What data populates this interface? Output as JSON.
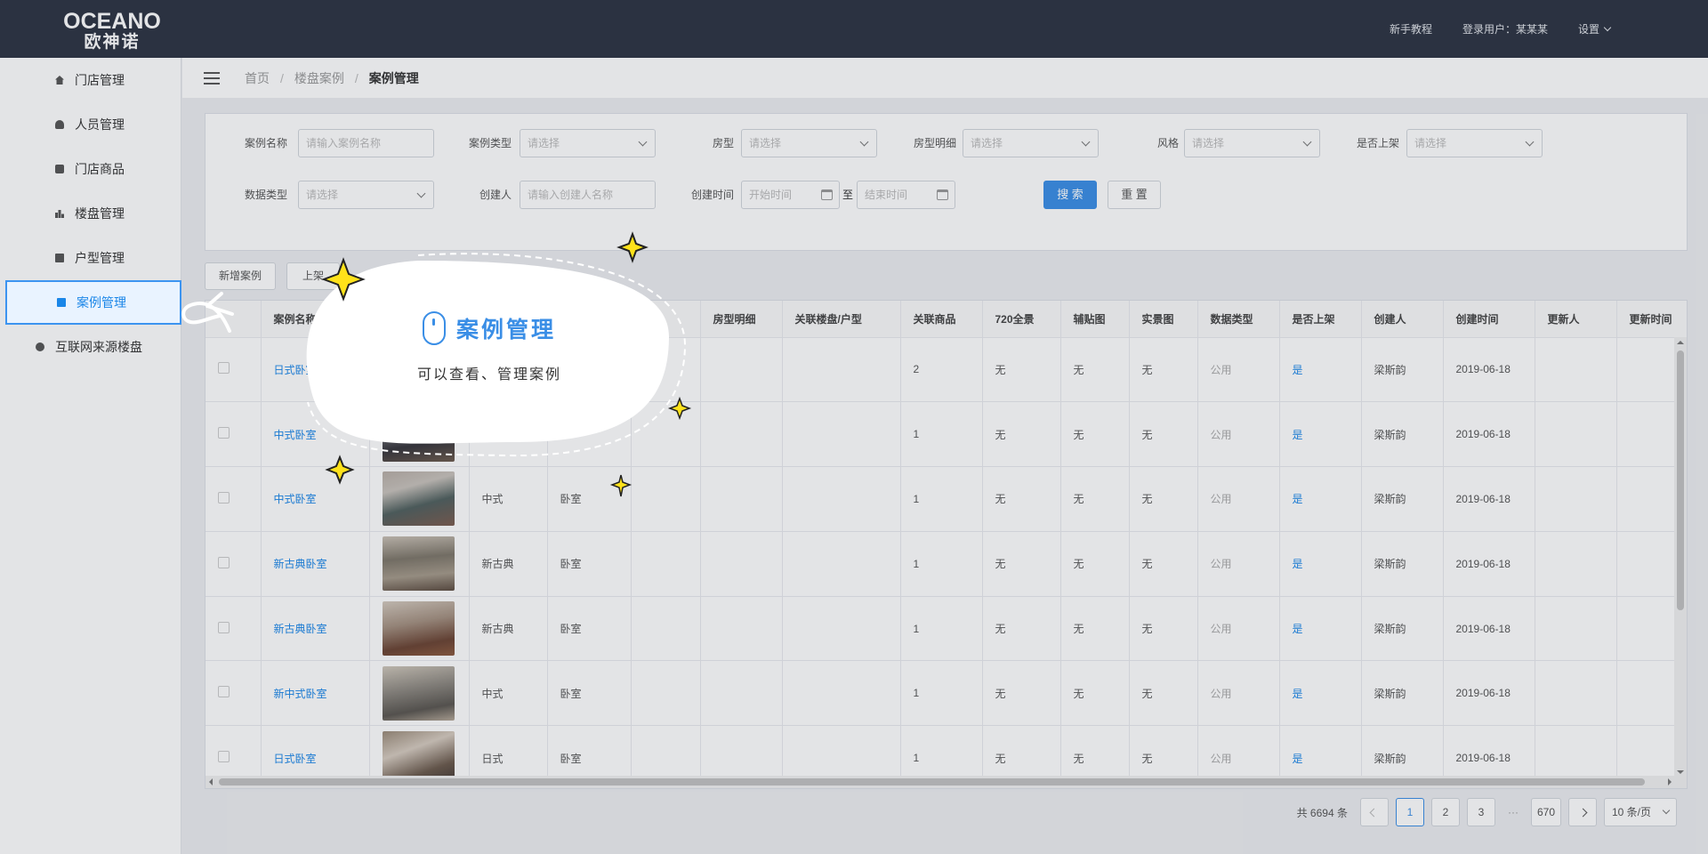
{
  "brand": {
    "en": "OCEANO",
    "cn": "欧神诺"
  },
  "header": {
    "tutorial": "新手教程",
    "user": "登录用户：某某某",
    "settings": "设置"
  },
  "sidebar": {
    "items": [
      {
        "label": "门店管理",
        "icon": "home-icon"
      },
      {
        "label": "人员管理",
        "icon": "user-icon"
      },
      {
        "label": "门店商品",
        "icon": "box-icon"
      },
      {
        "label": "楼盘管理",
        "icon": "bar-chart-icon"
      },
      {
        "label": "户型管理",
        "icon": "card-icon"
      },
      {
        "label": "案例管理",
        "icon": "image-icon",
        "active": true
      },
      {
        "label": "互联网来源楼盘",
        "icon": "globe-icon"
      }
    ]
  },
  "breadcrumb": [
    "首页",
    "楼盘案例",
    "案例管理"
  ],
  "filters": {
    "case_name": {
      "label": "案例名称",
      "placeholder": "请输入案例名称"
    },
    "case_type": {
      "label": "案例类型",
      "placeholder": "请选择"
    },
    "room_type": {
      "label": "房型",
      "placeholder": "请选择"
    },
    "room_detail": {
      "label": "房型明细",
      "placeholder": "请选择"
    },
    "style": {
      "label": "风格",
      "placeholder": "请选择"
    },
    "on_shelf": {
      "label": "是否上架",
      "placeholder": "请选择"
    },
    "data_type": {
      "label": "数据类型",
      "placeholder": "请选择"
    },
    "creator": {
      "label": "创建人",
      "placeholder": "请输入创建人名称"
    },
    "created_time": {
      "label": "创建时间",
      "start": "开始时间",
      "to": "至",
      "end": "结束时间"
    },
    "search": "搜 索",
    "reset": "重 置"
  },
  "actions": {
    "add": "新增案例",
    "shelf": "上架"
  },
  "table": {
    "headers": [
      "",
      "案例名称",
      "",
      "",
      "",
      "",
      "房型明细",
      "关联楼盘/户型",
      "关联商品",
      "720全景",
      "辅贴图",
      "实景图",
      "数据类型",
      "是否上架",
      "创建人",
      "创建时间",
      "更新人",
      "更新时间"
    ],
    "rows": [
      {
        "name": "日式卧室",
        "style": "",
        "room": "",
        "goods": "2",
        "pano": "无",
        "aux": "无",
        "real": "无",
        "dtype": "公用",
        "shelf": "是",
        "creator": "梁斯韵",
        "ctime": "2019-06-18"
      },
      {
        "name": "中式卧室",
        "style": "",
        "room": "",
        "goods": "1",
        "pano": "无",
        "aux": "无",
        "real": "无",
        "dtype": "公用",
        "shelf": "是",
        "creator": "梁斯韵",
        "ctime": "2019-06-18"
      },
      {
        "name": "中式卧室",
        "style": "中式",
        "room": "卧室",
        "goods": "1",
        "pano": "无",
        "aux": "无",
        "real": "无",
        "dtype": "公用",
        "shelf": "是",
        "creator": "梁斯韵",
        "ctime": "2019-06-18"
      },
      {
        "name": "新古典卧室",
        "style": "新古典",
        "room": "卧室",
        "goods": "1",
        "pano": "无",
        "aux": "无",
        "real": "无",
        "dtype": "公用",
        "shelf": "是",
        "creator": "梁斯韵",
        "ctime": "2019-06-18"
      },
      {
        "name": "新古典卧室",
        "style": "新古典",
        "room": "卧室",
        "goods": "1",
        "pano": "无",
        "aux": "无",
        "real": "无",
        "dtype": "公用",
        "shelf": "是",
        "creator": "梁斯韵",
        "ctime": "2019-06-18"
      },
      {
        "name": "新中式卧室",
        "style": "中式",
        "room": "卧室",
        "goods": "1",
        "pano": "无",
        "aux": "无",
        "real": "无",
        "dtype": "公用",
        "shelf": "是",
        "creator": "梁斯韵",
        "ctime": "2019-06-18"
      },
      {
        "name": "日式卧室",
        "style": "日式",
        "room": "卧室",
        "goods": "1",
        "pano": "无",
        "aux": "无",
        "real": "无",
        "dtype": "公用",
        "shelf": "是",
        "creator": "梁斯韵",
        "ctime": "2019-06-18"
      }
    ]
  },
  "pagination": {
    "total": "共 6694 条",
    "pages": [
      "1",
      "2",
      "3"
    ],
    "ellipsis": "···",
    "last": "670",
    "size": "10 条/页",
    "current": "1"
  },
  "tooltip": {
    "title": "案例管理",
    "subtitle": "可以查看、管理案例",
    "icon": "mouse-icon"
  },
  "colors": {
    "accent": "#3a8ee6",
    "header_bg": "#2c3342",
    "tooltip_star": "#ffe21a"
  }
}
